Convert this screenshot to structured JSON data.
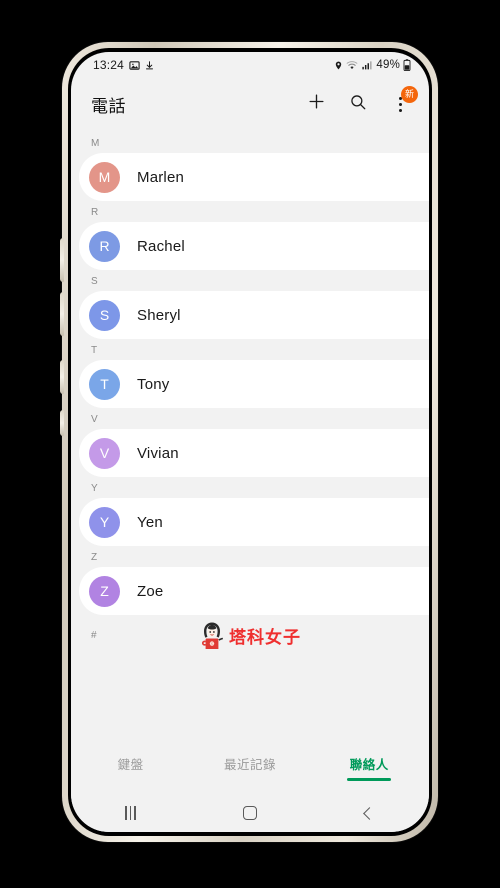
{
  "status_bar": {
    "time": "13:24",
    "left_icons": [
      "image-icon",
      "download-icon"
    ],
    "right_icons": [
      "location-icon",
      "wifi-icon",
      "signal-icon"
    ],
    "battery_percent": "49%"
  },
  "header": {
    "title": "電話",
    "add_icon": "plus-icon",
    "search_icon": "search-icon",
    "more_icon": "kebab-menu-icon",
    "badge_label": "新",
    "badge_color": "#f4660c"
  },
  "contacts": {
    "sections": [
      {
        "letter": "M",
        "items": [
          {
            "initial": "M",
            "name": "Marlen",
            "color": "#e39589"
          }
        ]
      },
      {
        "letter": "R",
        "items": [
          {
            "initial": "R",
            "name": "Rachel",
            "color": "#7d9ae4"
          }
        ]
      },
      {
        "letter": "S",
        "items": [
          {
            "initial": "S",
            "name": "Sheryl",
            "color": "#7d97e8"
          }
        ]
      },
      {
        "letter": "T",
        "items": [
          {
            "initial": "T",
            "name": "Tony",
            "color": "#7aa6e8"
          }
        ]
      },
      {
        "letter": "V",
        "items": [
          {
            "initial": "V",
            "name": "Vivian",
            "color": "#c49ae8"
          }
        ]
      },
      {
        "letter": "Y",
        "items": [
          {
            "initial": "Y",
            "name": "Yen",
            "color": "#8f92ea"
          }
        ]
      },
      {
        "letter": "Z",
        "items": [
          {
            "initial": "Z",
            "name": "Zoe",
            "color": "#b183e2"
          }
        ]
      }
    ],
    "index_footer": "#"
  },
  "watermark": {
    "text": "塔科女子",
    "color": "#ef2f2f",
    "mascot": "girl-with-mug-icon"
  },
  "tabs": [
    {
      "label": "鍵盤",
      "active": false,
      "name": "tab-keypad"
    },
    {
      "label": "最近記錄",
      "active": false,
      "name": "tab-recents"
    },
    {
      "label": "聯絡人",
      "active": true,
      "name": "tab-contacts"
    }
  ],
  "tab_accent_color": "#009a5a",
  "nav_bar": {
    "recents_icon": "recents-icon",
    "home_icon": "home-icon",
    "back_icon": "back-icon"
  }
}
